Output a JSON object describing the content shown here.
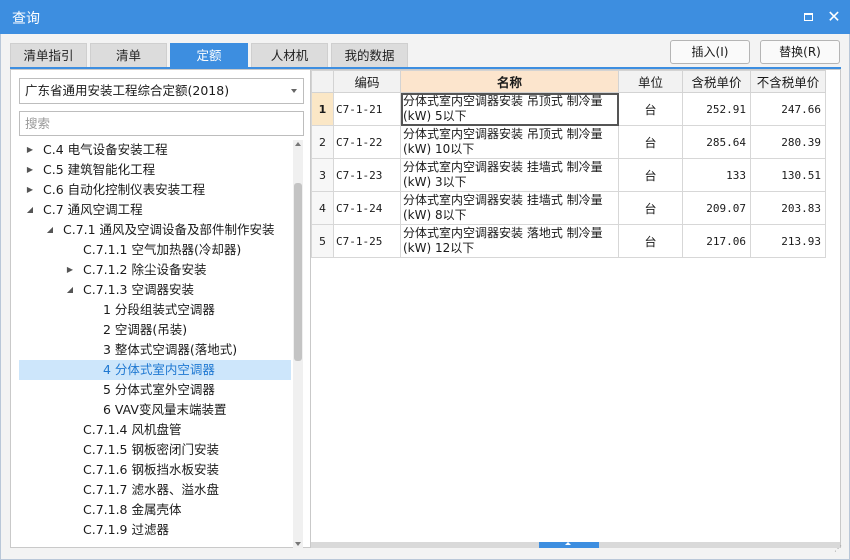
{
  "window": {
    "title": "查询"
  },
  "tabs": [
    {
      "label": "清单指引"
    },
    {
      "label": "清单"
    },
    {
      "label": "定额"
    },
    {
      "label": "人材机"
    },
    {
      "label": "我的数据"
    }
  ],
  "actions": {
    "insert_label": "插入(I)",
    "replace_label": "替换(R)"
  },
  "left": {
    "library_select": "广东省通用安装工程综合定额(2018)",
    "search_placeholder": "搜索"
  },
  "tree": [
    {
      "label": "C.4 电气设备安装工程",
      "arrow": "right"
    },
    {
      "label": "C.5 建筑智能化工程",
      "arrow": "right"
    },
    {
      "label": "C.6 自动化控制仪表安装工程",
      "arrow": "right"
    },
    {
      "label": "C.7 通风空调工程",
      "arrow": "down"
    },
    {
      "label": "C.7.1 通风及空调设备及部件制作安装",
      "arrow": "down"
    },
    {
      "label": "C.7.1.1 空气加热器(冷却器)",
      "arrow": ""
    },
    {
      "label": "C.7.1.2 除尘设备安装",
      "arrow": "right"
    },
    {
      "label": "C.7.1.3 空调器安装",
      "arrow": "down"
    },
    {
      "label": "1 分段组装式空调器",
      "arrow": ""
    },
    {
      "label": "2 空调器(吊装)",
      "arrow": ""
    },
    {
      "label": "3 整体式空调器(落地式)",
      "arrow": ""
    },
    {
      "label": "4 分体式室内空调器",
      "arrow": "",
      "selected": true
    },
    {
      "label": "5 分体式室外空调器",
      "arrow": ""
    },
    {
      "label": "6 VAV变风量末端装置",
      "arrow": ""
    },
    {
      "label": "C.7.1.4 风机盘管",
      "arrow": ""
    },
    {
      "label": "C.7.1.5 钢板密闭门安装",
      "arrow": ""
    },
    {
      "label": "C.7.1.6 钢板挡水板安装",
      "arrow": ""
    },
    {
      "label": "C.7.1.7 滤水器、溢水盘",
      "arrow": ""
    },
    {
      "label": "C.7.1.8 金属壳体",
      "arrow": ""
    },
    {
      "label": "C.7.1.9 过滤器",
      "arrow": ""
    }
  ],
  "table": {
    "headers": [
      "",
      "编码",
      "名称",
      "单位",
      "含税单价",
      "不含税单价"
    ],
    "rows": [
      {
        "no": "1",
        "code": "C7-1-21",
        "name": "分体式室内空调器安装 吊顶式 制冷量(kW) 5以下",
        "unit": "台",
        "price_tax": "252.91",
        "price_notax": "247.66"
      },
      {
        "no": "2",
        "code": "C7-1-22",
        "name": "分体式室内空调器安装 吊顶式 制冷量(kW) 10以下",
        "unit": "台",
        "price_tax": "285.64",
        "price_notax": "280.39"
      },
      {
        "no": "3",
        "code": "C7-1-23",
        "name": "分体式室内空调器安装 挂墙式 制冷量(kW) 3以下",
        "unit": "台",
        "price_tax": "133",
        "price_notax": "130.51"
      },
      {
        "no": "4",
        "code": "C7-1-24",
        "name": "分体式室内空调器安装 挂墙式 制冷量(kW) 8以下",
        "unit": "台",
        "price_tax": "209.07",
        "price_notax": "203.83"
      },
      {
        "no": "5",
        "code": "C7-1-25",
        "name": "分体式室内空调器安装 落地式 制冷量(kW) 12以下",
        "unit": "台",
        "price_tax": "217.06",
        "price_notax": "213.93"
      }
    ]
  },
  "colors": {
    "accent": "#3d8ee0",
    "selected_bg": "#cde6fb",
    "header_highlight": "#fce5cd"
  }
}
